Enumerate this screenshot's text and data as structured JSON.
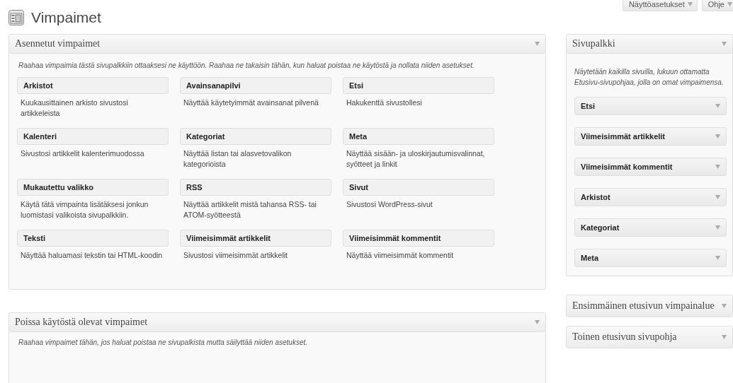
{
  "page_title": "Vimpaimet",
  "top_buttons": [
    {
      "label": "Näyttöasetukset"
    },
    {
      "label": "Ohje"
    }
  ],
  "available": {
    "title": "Asennetut vimpaimet",
    "description": "Raahaa vimpaimia tästä sivupalkkiin ottaaksesi ne käyttöön. Raahaa ne takaisin tähän, kun haluat poistaa ne käytöstä ja nollata niiden asetukset.",
    "widgets": [
      {
        "title": "Arkistot",
        "description": "Kuukausittainen arkisto sivustosi artikkeleista"
      },
      {
        "title": "Avainsanapilvi",
        "description": "Näyttää käytetyimmät avainsanat pilvenä"
      },
      {
        "title": "Etsi",
        "description": "Hakukenttä sivustollesi"
      },
      {
        "title": "Kalenteri",
        "description": "Sivustosi artikkelit kalenterimuodossa"
      },
      {
        "title": "Kategoriat",
        "description": "Näyttää listan tai alasvetovalikon kategorioista"
      },
      {
        "title": "Meta",
        "description": "Näyttää sisään- ja uloskirjautumisvalinnat, syötteet ja linkit"
      },
      {
        "title": "Mukautettu valikko",
        "description": "Käytä tätä vimpainta lisätäksesi jonkun luomistasi valikoista sivupalkkiin."
      },
      {
        "title": "RSS",
        "description": "Näyttää artikkelit mistä tahansa RSS- tai ATOM-syötteestä"
      },
      {
        "title": "Sivut",
        "description": "Sivustosi WordPress-sivut"
      },
      {
        "title": "Teksti",
        "description": "Näyttää haluamasi tekstin tai HTML-koodin"
      },
      {
        "title": "Viimeisimmät artikkelit",
        "description": "Sivustosi viimeisimmät artikkelit"
      },
      {
        "title": "Viimeisimmät kommentit",
        "description": "Näyttää viimeisimmät kommentit"
      }
    ]
  },
  "inactive": {
    "title": "Poissa käytöstä olevat vimpaimet",
    "description": "Raahaa vimpaimet tähän, jos haluat poistaa ne sivupalkista mutta säilyttää niiden asetukset."
  },
  "sidebars": [
    {
      "title": "Sivupalkki",
      "expanded": true,
      "description": "Näytetään kaikilla sivuilla, lukuun ottamatta Etusivu-sivupohjaa, jolla on omat vimpaimensa.",
      "widgets": [
        {
          "title": "Etsi"
        },
        {
          "title": "Viimeisimmät artikkelit"
        },
        {
          "title": "Viimeisimmät kommentit"
        },
        {
          "title": "Arkistot"
        },
        {
          "title": "Kategoriat"
        },
        {
          "title": "Meta"
        }
      ]
    },
    {
      "title": "Ensimmäinen etusivun vimpainalue",
      "expanded": false
    },
    {
      "title": "Toinen etusivun sivupohja",
      "expanded": false
    }
  ]
}
